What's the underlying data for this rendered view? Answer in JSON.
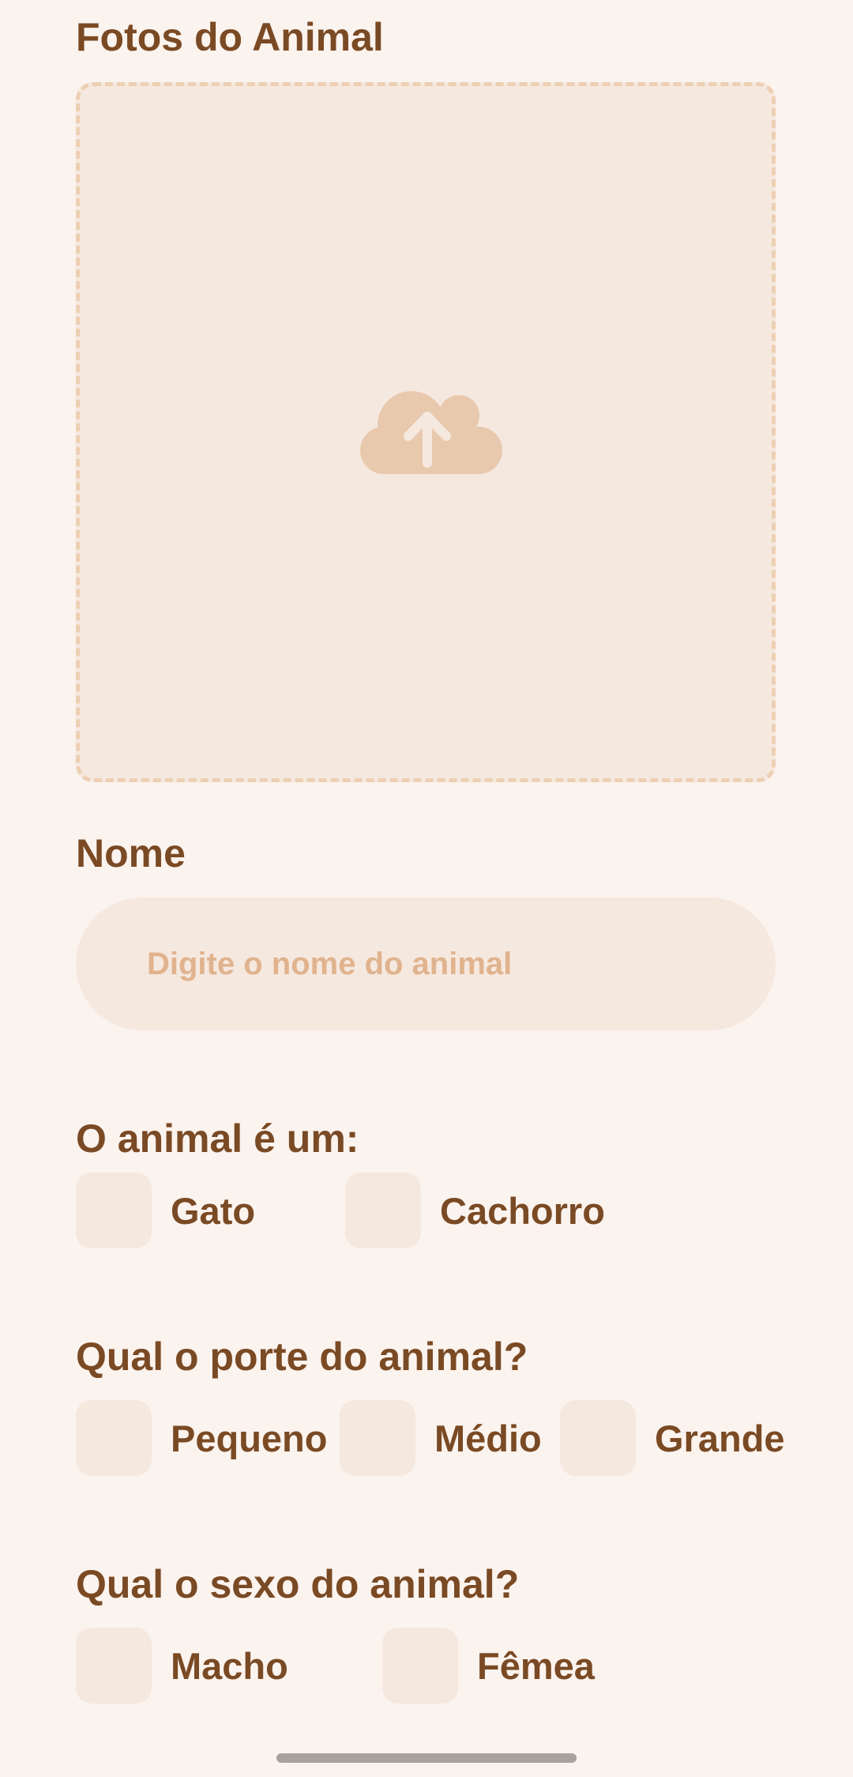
{
  "photos": {
    "title": "Fotos do Animal",
    "icon": "cloud-upload-icon"
  },
  "name": {
    "title": "Nome",
    "placeholder": "Digite o nome do animal",
    "value": ""
  },
  "species": {
    "title": "O animal é um:",
    "options": [
      "Gato",
      "Cachorro"
    ]
  },
  "size": {
    "title": "Qual o porte do animal?",
    "options": [
      "Pequeno",
      "Médio",
      "Grande"
    ]
  },
  "sex": {
    "title": "Qual o sexo do animal?",
    "options": [
      "Macho",
      "Fêmea"
    ]
  },
  "colors": {
    "background": "#FBF3EE",
    "field": "#F5E8DF",
    "text": "#7A4A24",
    "placeholder": "#E0B38E",
    "upload_border": "#EDCFB2",
    "upload_icon": "#E8C9AE"
  }
}
